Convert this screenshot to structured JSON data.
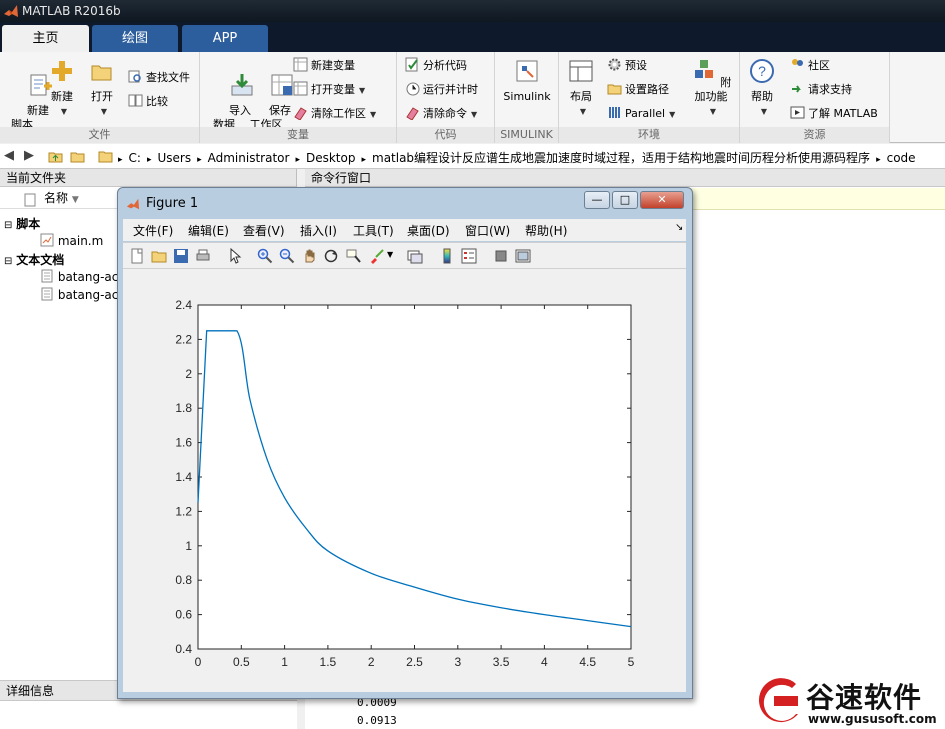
{
  "window": {
    "title": "MATLAB R2016b"
  },
  "tabs": [
    {
      "label": "主页"
    },
    {
      "label": "绘图"
    },
    {
      "label": "APP"
    }
  ],
  "ribbon": {
    "file": {
      "label": "文件",
      "new_script": "新建\n脚本",
      "new": "新建",
      "open": "打开",
      "find_files": "查找文件",
      "compare": "比较"
    },
    "variable": {
      "label": "变量",
      "import_data": "导入\n数据",
      "save_workspace": "保存\n工作区",
      "new_variable": "新建变量",
      "open_variable": "打开变量",
      "clear_workspace": "清除工作区"
    },
    "code": {
      "label": "代码",
      "analyze_code": "分析代码",
      "run_and_time": "运行并计时",
      "clear_commands": "清除命令"
    },
    "simulink": {
      "label": "SIMULINK",
      "simulink": "Simulink"
    },
    "environment": {
      "label": "环境",
      "layout": "布局",
      "preferences": "预设",
      "set_path": "设置路径",
      "parallel": "Parallel",
      "addons": "附加功能"
    },
    "resources": {
      "label": "资源",
      "help": "帮助",
      "community": "社区",
      "request_support": "请求支持",
      "learn_matlab": "了解 MATLAB"
    }
  },
  "address": {
    "crumbs": [
      "C:",
      "Users",
      "Administrator",
      "Desktop",
      "matlab编程设计反应谱生成地震加速度时域过程，适用于结构地震时间历程分析使用源码程序",
      "code"
    ]
  },
  "current_folder": {
    "title": "当前文件夹",
    "column_name": "名称",
    "groups": [
      {
        "label": "脚本",
        "files": [
          "main.m"
        ]
      },
      {
        "label": "文本文档",
        "files": [
          "batang-ac",
          "batang-ac"
        ]
      }
    ]
  },
  "details": {
    "title": "详细信息"
  },
  "command_window": {
    "title": "命令行窗口",
    "outputs": [
      "0.0009",
      "0.0913"
    ]
  },
  "figure": {
    "title": "Figure 1",
    "menu": [
      "文件(F)",
      "编辑(E)",
      "查看(V)",
      "插入(I)",
      "工具(T)",
      "桌面(D)",
      "窗口(W)",
      "帮助(H)"
    ],
    "window_buttons": {
      "minimize": "—",
      "maximize": "□",
      "close": "✕"
    }
  },
  "chart_data": {
    "type": "line",
    "xlim": [
      0,
      5
    ],
    "ylim": [
      0.4,
      2.4
    ],
    "xticks": [
      0,
      0.5,
      1,
      1.5,
      2,
      2.5,
      3,
      3.5,
      4,
      4.5,
      5
    ],
    "yticks": [
      0.4,
      0.6,
      0.8,
      1,
      1.2,
      1.4,
      1.6,
      1.8,
      2,
      2.2,
      2.4
    ],
    "xtick_labels": [
      "0",
      "0.5",
      "1",
      "1.5",
      "2",
      "2.5",
      "3",
      "3.5",
      "4",
      "4.5",
      "5"
    ],
    "ytick_labels": [
      "0.4",
      "0.6",
      "0.8",
      "1",
      "1.2",
      "1.4",
      "1.6",
      "1.8",
      "2",
      "2.2",
      "2.4"
    ],
    "grid": false,
    "series": [
      {
        "color": "#0072bd",
        "x": [
          0,
          0.02,
          0.04,
          0.06,
          0.08,
          0.1,
          0.45,
          0.6,
          0.8,
          1.0,
          1.25,
          1.5,
          2.0,
          2.5,
          3.0,
          3.5,
          4.0,
          4.5,
          5.0
        ],
        "y": [
          1.25,
          1.45,
          1.65,
          1.85,
          2.05,
          2.25,
          2.25,
          1.85,
          1.5,
          1.28,
          1.1,
          0.97,
          0.84,
          0.76,
          0.69,
          0.64,
          0.6,
          0.565,
          0.53
        ]
      }
    ]
  },
  "watermark": {
    "brand": "谷速软件",
    "url": "www.gususoft.com"
  },
  "colors": {
    "tabbar": "#0e1a2b",
    "tab_active": "#f0f0f0",
    "tab_inactive": "#2c5d9c",
    "figure_frame": "#b8cde0",
    "plot_line": "#0072bd"
  }
}
